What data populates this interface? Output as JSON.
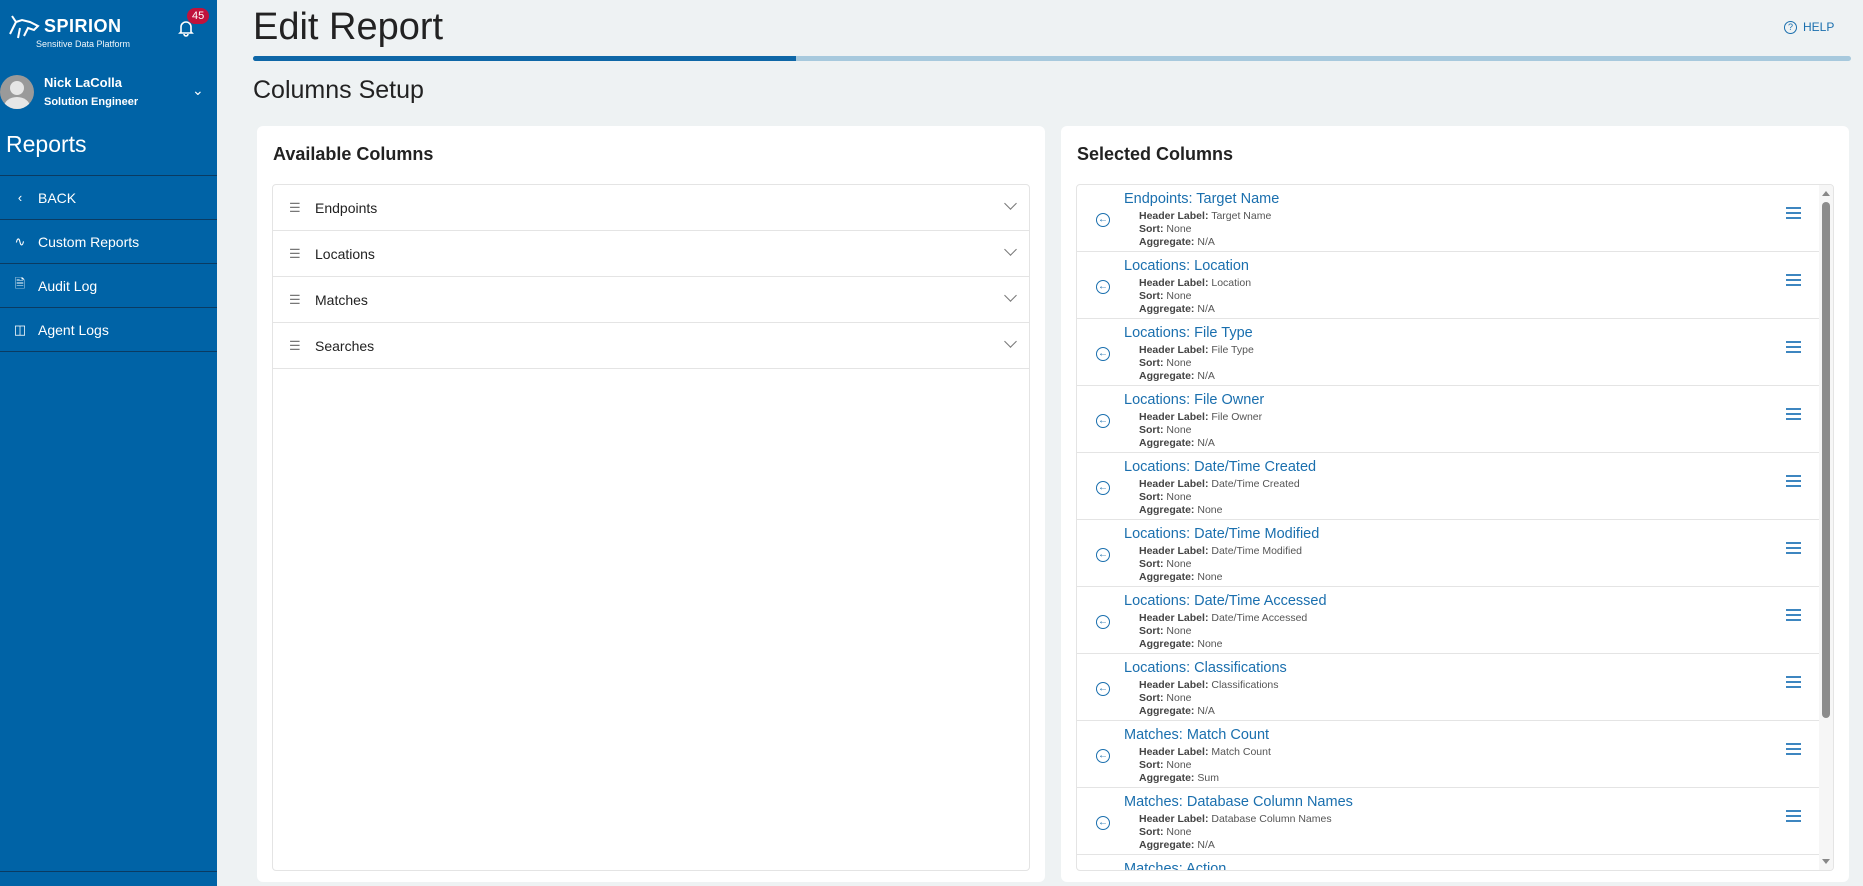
{
  "sidebar": {
    "brand": "SPIRION",
    "tagline": "Sensitive Data Platform",
    "notifications": "45",
    "user": {
      "name": "Nick LaColla",
      "role": "Solution Engineer"
    },
    "section": "Reports",
    "items": [
      {
        "label": "BACK",
        "icon": "chevron-left-icon"
      },
      {
        "label": "Custom Reports",
        "icon": "chart-line-icon"
      },
      {
        "label": "Audit Log",
        "icon": "document-search-icon"
      },
      {
        "label": "Agent Logs",
        "icon": "monitor-icon"
      }
    ]
  },
  "header": {
    "title": "Edit Report",
    "help": "HELP",
    "progress_percent": 34,
    "subtitle": "Columns Setup"
  },
  "available": {
    "title": "Available Columns",
    "groups": [
      "Endpoints",
      "Locations",
      "Matches",
      "Searches"
    ]
  },
  "selected": {
    "title": "Selected Columns",
    "labels": {
      "header": "Header Label:",
      "sort": "Sort:",
      "aggregate": "Aggregate:"
    },
    "items": [
      {
        "title": "Endpoints: Target Name",
        "header": "Target Name",
        "sort": "None",
        "aggregate": "N/A"
      },
      {
        "title": "Locations: Location",
        "header": "Location",
        "sort": "None",
        "aggregate": "N/A"
      },
      {
        "title": "Locations: File Type",
        "header": "File Type",
        "sort": "None",
        "aggregate": "N/A"
      },
      {
        "title": "Locations: File Owner",
        "header": "File Owner",
        "sort": "None",
        "aggregate": "N/A"
      },
      {
        "title": "Locations: Date/Time Created",
        "header": "Date/Time Created",
        "sort": "None",
        "aggregate": "None"
      },
      {
        "title": "Locations: Date/Time Modified",
        "header": "Date/Time Modified",
        "sort": "None",
        "aggregate": "None"
      },
      {
        "title": "Locations: Date/Time Accessed",
        "header": "Date/Time Accessed",
        "sort": "None",
        "aggregate": "None"
      },
      {
        "title": "Locations: Classifications",
        "header": "Classifications",
        "sort": "None",
        "aggregate": "N/A"
      },
      {
        "title": "Matches: Match Count",
        "header": "Match Count",
        "sort": "None",
        "aggregate": "Sum"
      },
      {
        "title": "Matches: Database Column Names",
        "header": "Database Column Names",
        "sort": "None",
        "aggregate": "N/A"
      },
      {
        "title": "Matches: Action",
        "header": "",
        "sort": "",
        "aggregate": ""
      }
    ]
  }
}
